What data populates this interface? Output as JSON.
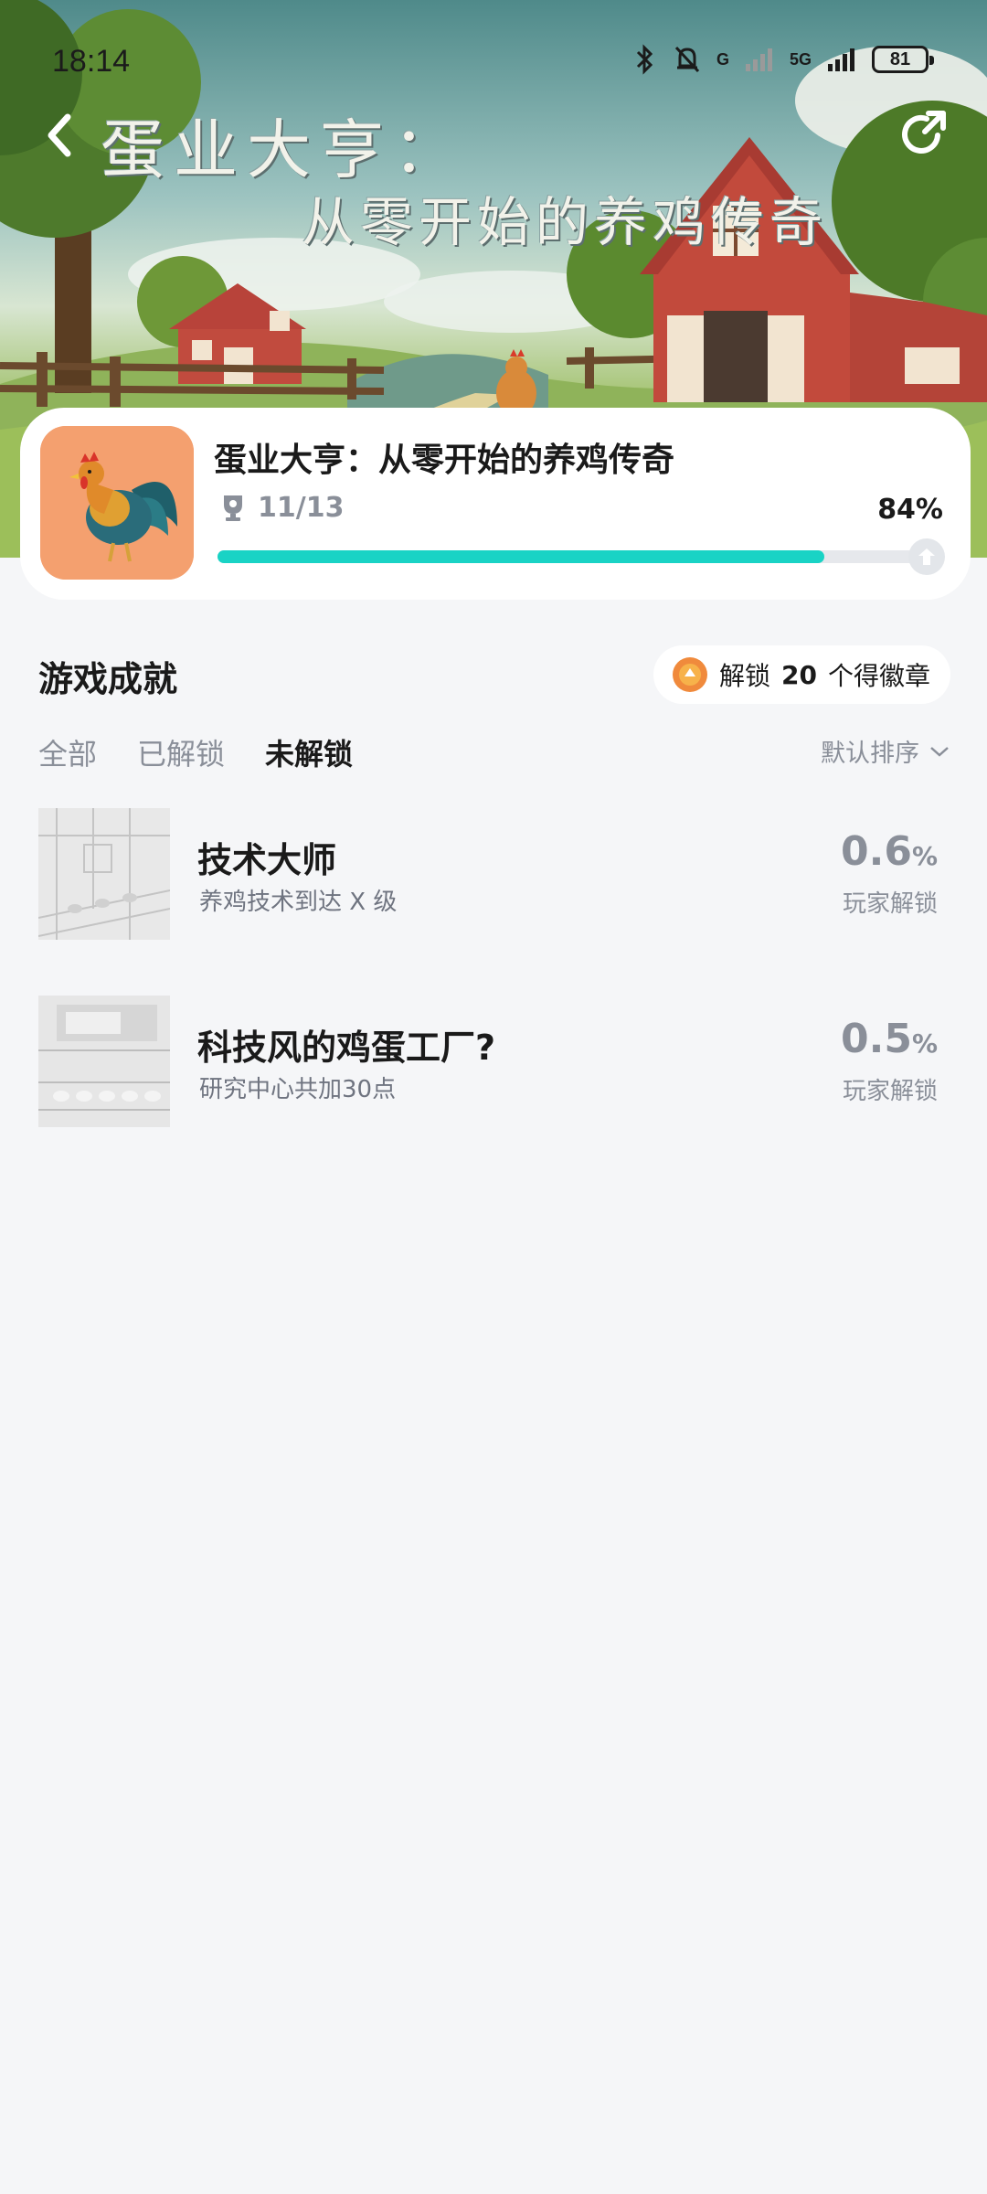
{
  "status_bar": {
    "time": "18:14",
    "network_1": "G",
    "network_2": "5G",
    "battery": "81"
  },
  "banner": {
    "title_line1": "蛋业大亨：",
    "title_line2": "从零开始的养鸡传奇"
  },
  "game": {
    "name": "蛋业大亨：从零开始的养鸡传奇",
    "achievements_count": "11/13",
    "progress_label": "84%",
    "progress": 0.84
  },
  "achievements_section": {
    "title": "游戏成就",
    "badge_prefix": "解锁",
    "badge_count": "20",
    "badge_suffix": "个得徽章",
    "tabs": [
      {
        "label": "全部",
        "active": false
      },
      {
        "label": "已解锁",
        "active": false
      },
      {
        "label": "未解锁",
        "active": true
      }
    ],
    "sort_label": "默认排序"
  },
  "achievements": [
    {
      "title": "技术大师",
      "desc": "养鸡技术到达 X 级",
      "rate": "0.6",
      "rate_unit": "%",
      "rate_label": "玩家解锁"
    },
    {
      "title": "科技风的鸡蛋工厂?",
      "desc": "研究中心共加30点",
      "rate": "0.5",
      "rate_unit": "%",
      "rate_label": "玩家解锁"
    }
  ],
  "colors": {
    "accent": "#19d3c5",
    "background": "#f5f6f8",
    "muted_text": "#8a8f99"
  }
}
